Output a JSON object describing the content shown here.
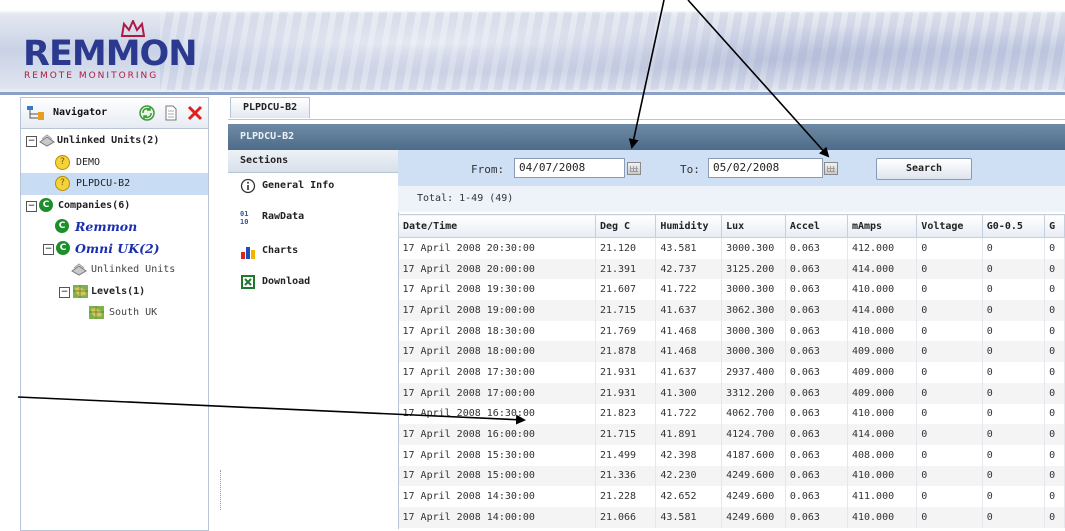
{
  "app": {
    "logo_text": "REMMON",
    "logo_subtitle": "REMOTE MONITORING"
  },
  "navigator": {
    "title": "Navigator",
    "tree": [
      {
        "label": "Unlinked Units(2)"
      },
      {
        "label": "DEMO"
      },
      {
        "label": "PLPDCU-B2"
      },
      {
        "label": "Companies(6)"
      },
      {
        "label": "Remmon"
      },
      {
        "label": "Omni UK(2)"
      },
      {
        "label": "Unlinked Units"
      },
      {
        "label": "Levels(1)"
      },
      {
        "label": "South UK"
      }
    ]
  },
  "top_tab": "PLPDCU-B2",
  "panel_title": "PLPDCU-B2",
  "sections": {
    "header": "Sections",
    "items": [
      {
        "label": "General Info"
      },
      {
        "label": "RawData"
      },
      {
        "label": "Charts"
      },
      {
        "label": "Download"
      }
    ]
  },
  "filter": {
    "from_label": "From:",
    "from_value": "04/07/2008",
    "to_label": "To:",
    "to_value": "05/02/2008",
    "search_label": "Search"
  },
  "totals": "Total:  1-49 (49)",
  "table": {
    "columns": [
      "Date/Time",
      "Deg C",
      "Humidity",
      "Lux",
      "Accel",
      "mAmps",
      "Voltage",
      "G0-0.5",
      "G"
    ],
    "rows": [
      [
        "17 April 2008 20:30:00",
        "21.120",
        "43.581",
        "3000.300",
        "0.063",
        "412.000",
        "0",
        "0",
        "0"
      ],
      [
        "17 April 2008 20:00:00",
        "21.391",
        "42.737",
        "3125.200",
        "0.063",
        "414.000",
        "0",
        "0",
        "0"
      ],
      [
        "17 April 2008 19:30:00",
        "21.607",
        "41.722",
        "3000.300",
        "0.063",
        "410.000",
        "0",
        "0",
        "0"
      ],
      [
        "17 April 2008 19:00:00",
        "21.715",
        "41.637",
        "3062.300",
        "0.063",
        "414.000",
        "0",
        "0",
        "0"
      ],
      [
        "17 April 2008 18:30:00",
        "21.769",
        "41.468",
        "3000.300",
        "0.063",
        "410.000",
        "0",
        "0",
        "0"
      ],
      [
        "17 April 2008 18:00:00",
        "21.878",
        "41.468",
        "3000.300",
        "0.063",
        "409.000",
        "0",
        "0",
        "0"
      ],
      [
        "17 April 2008 17:30:00",
        "21.931",
        "41.637",
        "2937.400",
        "0.063",
        "409.000",
        "0",
        "0",
        "0"
      ],
      [
        "17 April 2008 17:00:00",
        "21.931",
        "41.300",
        "3312.200",
        "0.063",
        "409.000",
        "0",
        "0",
        "0"
      ],
      [
        "17 April 2008 16:30:00",
        "21.823",
        "41.722",
        "4062.700",
        "0.063",
        "410.000",
        "0",
        "0",
        "0"
      ],
      [
        "17 April 2008 16:00:00",
        "21.715",
        "41.891",
        "4124.700",
        "0.063",
        "414.000",
        "0",
        "0",
        "0"
      ],
      [
        "17 April 2008 15:30:00",
        "21.499",
        "42.398",
        "4187.600",
        "0.063",
        "408.000",
        "0",
        "0",
        "0"
      ],
      [
        "17 April 2008 15:00:00",
        "21.336",
        "42.230",
        "4249.600",
        "0.063",
        "410.000",
        "0",
        "0",
        "0"
      ],
      [
        "17 April 2008 14:30:00",
        "21.228",
        "42.652",
        "4249.600",
        "0.063",
        "411.000",
        "0",
        "0",
        "0"
      ],
      [
        "17 April 2008 14:00:00",
        "21.066",
        "43.581",
        "4249.600",
        "0.063",
        "410.000",
        "0",
        "0",
        "0"
      ]
    ]
  },
  "colors": {
    "brand_blue": "#2b3a8f",
    "brand_red": "#b01845",
    "panel_title_bg": "#4d6c89",
    "filter_bg": "#cfe0f4",
    "selected_row": "#c8dcf3"
  }
}
